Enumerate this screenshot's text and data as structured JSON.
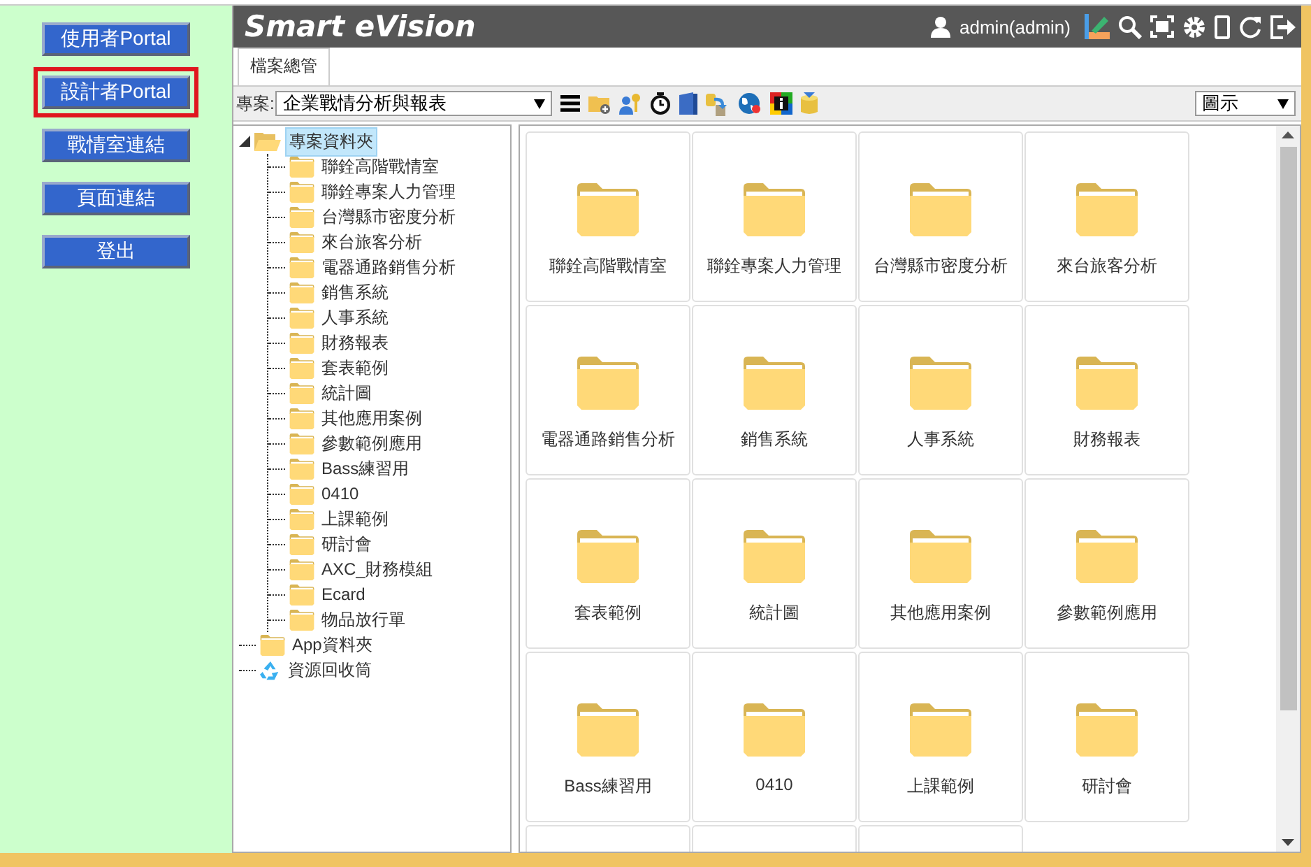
{
  "sidebar": {
    "buttons": [
      {
        "label": "使用者Portal",
        "selected": false
      },
      {
        "label": "設計者Portal",
        "selected": true
      },
      {
        "label": "戰情室連結",
        "selected": false
      },
      {
        "label": "頁面連結",
        "selected": false
      },
      {
        "label": "登出",
        "selected": false
      }
    ]
  },
  "header": {
    "title": "Smart eVision",
    "user": "admin(admin)"
  },
  "tabs": [
    {
      "label": "檔案總管",
      "selected": true
    }
  ],
  "toolbar": {
    "project_label": "專案:",
    "project_value": "企業戰情分析與報表",
    "view_value": "圖示"
  },
  "tree": [
    {
      "label": "專案資料夾",
      "kind": "folder",
      "selected": true,
      "expanded": true,
      "children": [
        {
          "label": "聯銓高階戰情室",
          "selected": false
        },
        {
          "label": "聯銓專案人力管理",
          "selected": false
        },
        {
          "label": "台灣縣市密度分析",
          "selected": false
        },
        {
          "label": "來台旅客分析",
          "selected": false
        },
        {
          "label": "電器通路銷售分析",
          "selected": false
        },
        {
          "label": "銷售系統",
          "selected": false
        },
        {
          "label": "人事系統",
          "selected": false
        },
        {
          "label": "財務報表",
          "selected": false
        },
        {
          "label": "套表範例",
          "selected": false
        },
        {
          "label": "統計圖",
          "selected": false
        },
        {
          "label": "其他應用案例",
          "selected": false
        },
        {
          "label": "參數範例應用",
          "selected": false
        },
        {
          "label": "Bass練習用",
          "selected": false
        },
        {
          "label": "0410",
          "selected": false
        },
        {
          "label": "上課範例",
          "selected": false
        },
        {
          "label": "研討會",
          "selected": false
        },
        {
          "label": "AXC_財務模組",
          "selected": false
        },
        {
          "label": "Ecard",
          "selected": false
        },
        {
          "label": "物品放行單",
          "selected": false
        }
      ]
    },
    {
      "label": "App資料夾",
      "kind": "folder",
      "selected": false
    },
    {
      "label": "資源回收筒",
      "kind": "recycle",
      "selected": false
    }
  ],
  "grid": {
    "items": [
      {
        "kind": "folder",
        "label": "聯銓高階戰情室"
      },
      {
        "kind": "folder",
        "label": "聯銓專案人力管理"
      },
      {
        "kind": "folder",
        "label": "台灣縣市密度分析"
      },
      {
        "kind": "folder",
        "label": "來台旅客分析"
      },
      {
        "kind": "folder",
        "label": "電器通路銷售分析"
      },
      {
        "kind": "folder",
        "label": "銷售系統"
      },
      {
        "kind": "folder",
        "label": "人事系統"
      },
      {
        "kind": "folder",
        "label": "財務報表"
      },
      {
        "kind": "folder",
        "label": "套表範例"
      },
      {
        "kind": "folder",
        "label": "統計圖"
      },
      {
        "kind": "folder",
        "label": "其他應用案例"
      },
      {
        "kind": "folder",
        "label": "參數範例應用"
      },
      {
        "kind": "folder",
        "label": "Bass練習用"
      },
      {
        "kind": "folder",
        "label": "0410"
      },
      {
        "kind": "folder",
        "label": "上課範例"
      },
      {
        "kind": "folder",
        "label": "研討會"
      },
      {
        "kind": "cut"
      },
      {
        "kind": "cut"
      },
      {
        "kind": "cut"
      }
    ]
  }
}
